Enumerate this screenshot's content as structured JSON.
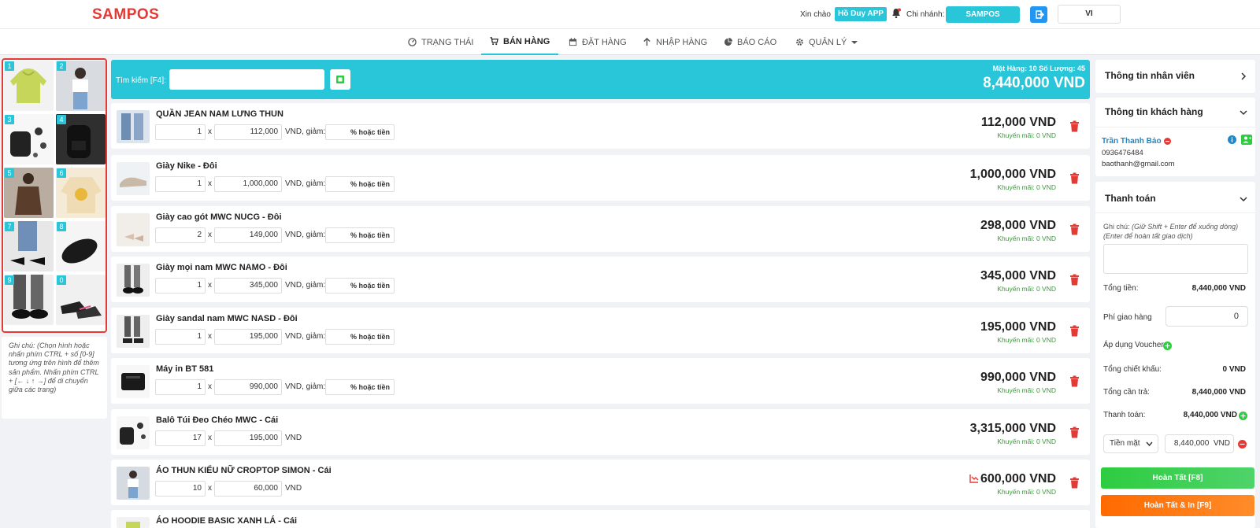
{
  "header": {
    "logo": "SAMPOS",
    "greeting": "Xin chào",
    "user": "Hồ Duy APP",
    "branch_label": "Chi nhánh:",
    "branch": "SAMPOS",
    "language": "VI"
  },
  "nav": [
    {
      "label": "TRẠNG THÁI",
      "icon": "dashboard-icon"
    },
    {
      "label": "BÁN HÀNG",
      "icon": "cart-icon"
    },
    {
      "label": "ĐẶT HÀNG",
      "icon": "calendar-icon"
    },
    {
      "label": "NHẬP HÀNG",
      "icon": "arrow-up-icon"
    },
    {
      "label": "BÁO CÁO",
      "icon": "pie-chart-icon"
    },
    {
      "label": "QUẢN LÝ",
      "icon": "gear-icon"
    }
  ],
  "thumbnails": [
    "1",
    "2",
    "3",
    "4",
    "5",
    "6",
    "7",
    "8",
    "9",
    "0"
  ],
  "note": "Ghi chú: (Chọn hình hoặc nhấn phím CTRL + số [0-9] tương ứng trên hình để thêm sản phẩm. Nhấn phím CTRL + [← ↓ ↑ →] để di chuyển giữa các trang)",
  "search": {
    "label": "Tìm kiếm [F4]:",
    "summary": "Mặt Hàng:  10  Số Lượng:  45",
    "total": "8,440,000 VND"
  },
  "labels": {
    "x": "x",
    "vnd_discount": "VND, giảm:",
    "vnd": "VND",
    "discount_placeholder": "% hoặc tiền"
  },
  "items": [
    {
      "name": "QUẦN JEAN NAM LƯNG THUN",
      "qty": "1",
      "price": "112,000",
      "total": "112,000 VND",
      "promo": "Khuyến mãi: 0 VND"
    },
    {
      "name": "Giày Nike - Đôi",
      "qty": "1",
      "price": "1,000,000",
      "total": "1,000,000 VND",
      "promo": "Khuyến mãi: 0 VND"
    },
    {
      "name": "Giày cao gót MWC NUCG - Đôi",
      "qty": "2",
      "price": "149,000",
      "total": "298,000 VND",
      "promo": "Khuyến mãi: 0 VND"
    },
    {
      "name": "Giày mọi nam MWC NAMO - Đôi",
      "qty": "1",
      "price": "345,000",
      "total": "345,000 VND",
      "promo": "Khuyến mãi: 0 VND"
    },
    {
      "name": "Giày sandal nam MWC NASD - Đôi",
      "qty": "1",
      "price": "195,000",
      "total": "195,000 VND",
      "promo": "Khuyến mãi: 0 VND"
    },
    {
      "name": "Máy in BT 581",
      "qty": "1",
      "price": "990,000",
      "total": "990,000 VND",
      "promo": "Khuyến mãi: 0 VND"
    },
    {
      "name": "Balô Túi Đeo Chéo MWC - Cái",
      "qty": "17",
      "price": "195,000",
      "total": "3,315,000 VND",
      "promo": "Khuyến mãi: 0 VND"
    },
    {
      "name": "ÁO THUN KIỂU NỮ CROPTOP SIMON - Cái",
      "qty": "10",
      "price": "60,000",
      "total": "600,000 VND",
      "promo": "Khuyến mãi: 0 VND"
    },
    {
      "name": "ÁO HOODIE BASIC XANH LÁ - Cái"
    }
  ],
  "right": {
    "staff_title": "Thông tin nhân viên",
    "customer_title": "Thông tin khách hàng",
    "customer_name": "Trần Thanh Bảo",
    "customer_phone": "0936476484",
    "customer_email": "baothanh@gmail.com",
    "payment_title": "Thanh toán",
    "note_label": "Ghi chú:",
    "note_hint": "(Giữ Shift + Enter để xuống dòng) (Enter để hoàn tất giao dịch)",
    "total_label": "Tổng tiền:",
    "total_value": "8,440,000 VND",
    "shipping_label": "Phí giao hàng",
    "shipping_value": "0",
    "voucher_label": "Áp dụng Voucher",
    "discount_label": "Tổng chiết khấu:",
    "discount_value": "0 VND",
    "due_label": "Tổng cần trả:",
    "due_value": "8,440,000 VND",
    "paid_label": "Thanh toán:",
    "paid_value": "8,440,000 VND",
    "method": "Tiền mặt",
    "method_amount": "8,440,000",
    "method_unit": "VND",
    "done_label": "Hoàn Tất [F8]",
    "done_print_label": "Hoàn Tất & In [F9]"
  },
  "colors": {
    "accent": "#29c5d8",
    "brand": "#e53935",
    "green": "#2ecc40",
    "orange": "#ff7a1a"
  }
}
